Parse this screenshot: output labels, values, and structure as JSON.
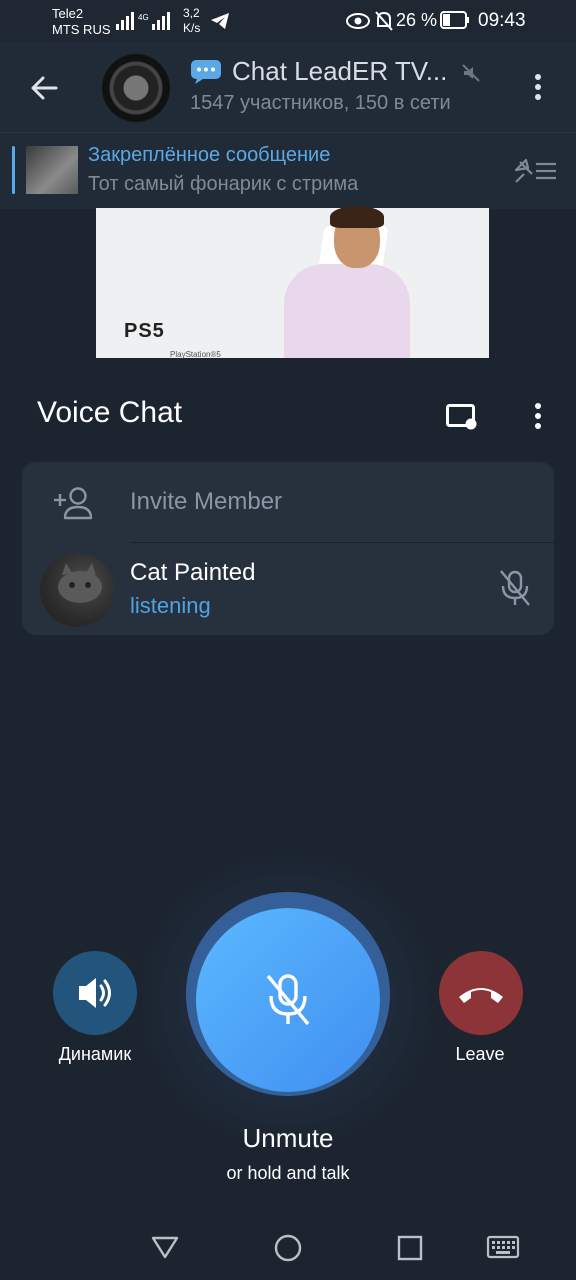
{
  "status_bar": {
    "carrier1": "Tele2",
    "carrier2": "MTS RUS",
    "net_speed": "3,2",
    "net_unit": "K/s",
    "battery": "26 %",
    "time": "09:43"
  },
  "chat": {
    "title": "Chat LeadER TV...",
    "subtitle": "1547 участников, 150 в сети"
  },
  "pinned": {
    "title": "Закреплённое сообщение",
    "text": "Тот самый фонарик с стрима"
  },
  "media": {
    "brand": "PS5",
    "brand_sub": "PlayStation®5"
  },
  "voice_chat": {
    "title": "Voice Chat",
    "invite_label": "Invite Member",
    "participants": [
      {
        "name": "Cat Painted",
        "status": "listening"
      }
    ],
    "speaker_label": "Динамик",
    "leave_label": "Leave",
    "unmute_label": "Unmute",
    "hold_hint": "or hold and talk"
  },
  "colors": {
    "accent": "#4fa3e3",
    "leave": "#8c3438",
    "background": "#1c2430"
  }
}
